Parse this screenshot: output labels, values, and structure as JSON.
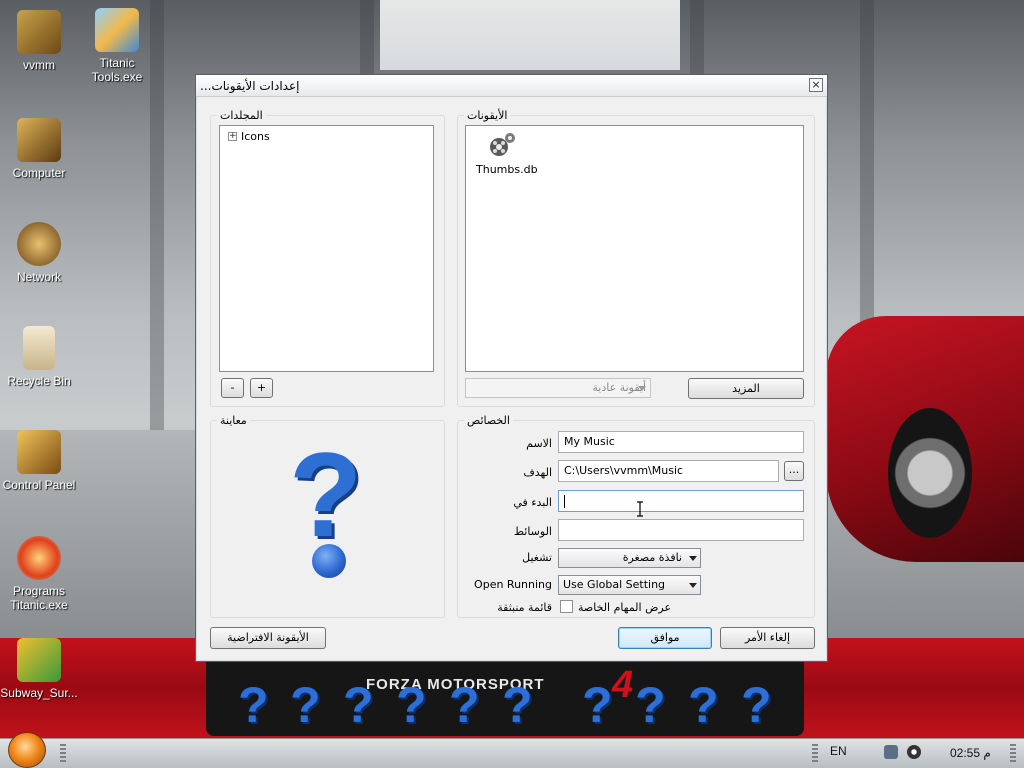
{
  "desktop": {
    "icons": [
      {
        "label": "vvmm"
      },
      {
        "label": "Titanic Tools.exe"
      },
      {
        "label": "Computer"
      },
      {
        "label": "Network"
      },
      {
        "label": "Recycle Bin"
      },
      {
        "label": "Control Panel"
      },
      {
        "label": "Programs Titanic.exe"
      },
      {
        "label": "Subway_Sur..."
      }
    ],
    "wallpaper": {
      "brand_text": "FORZA MOTORSPORT",
      "brand_number": "4",
      "question_glyph": "?"
    }
  },
  "dialog": {
    "title": "إعدادات الأيقونات...",
    "close_glyph": "×",
    "folders": {
      "label": "المجلدات",
      "tree_item": "Icons",
      "expander_glyph": "+",
      "remove_label": "-",
      "add_label": "+"
    },
    "icons": {
      "label": "الأيقونات",
      "file_name": "Thumbs.db",
      "icon_type_value": "أيقونة عادية",
      "more_label": "المزيد"
    },
    "preview": {
      "label": "معاينة",
      "glyph": "?"
    },
    "properties": {
      "label": "الخصائص",
      "name_label": "الاسم",
      "name_value": "My Music",
      "target_label": "الهدف",
      "target_value": "C:\\Users\\vvmm\\Music",
      "browse_label": "...",
      "start_in_label": "البدء في",
      "start_in_value": "",
      "args_label": "الوسائط",
      "args_value": "",
      "run_label": "تشغيل",
      "run_value": "نافذة مصغرة",
      "open_running_label": "Open Running",
      "open_running_value": "Use Global Setting",
      "popup_menu_label": "قائمة منبثقة",
      "show_tasks_label": "عرض المهام الخاصة",
      "show_tasks_checked": false
    },
    "buttons": {
      "default_icon": "الأيقونة الافتراضية",
      "ok": "موافق",
      "cancel": "إلغاء الأمر"
    }
  },
  "taskbar": {
    "language": "EN",
    "clock": "02:55 م"
  },
  "colors": {
    "banner_red": "#c4111c",
    "accent_blue": "#2e6fd4"
  }
}
